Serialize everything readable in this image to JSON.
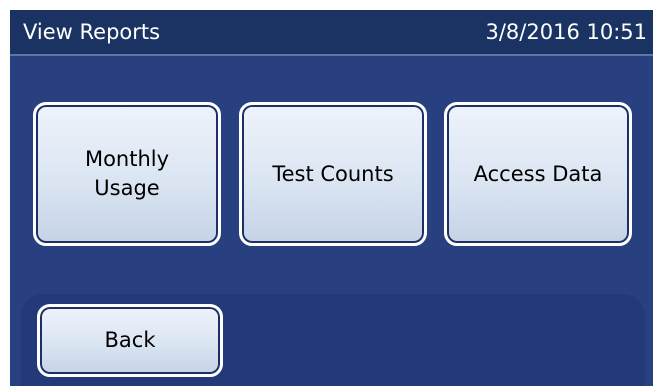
{
  "header": {
    "title": "View Reports",
    "datetime": "3/8/2016 10:51"
  },
  "buttons": {
    "monthly_usage_line1": "Monthly",
    "monthly_usage_line2": "Usage",
    "test_counts": "Test Counts",
    "access_data": "Access Data",
    "back": "Back"
  },
  "colors": {
    "header_background": "#1a3363",
    "screen_background": "#283f80",
    "footer_bar": "#23397a",
    "button_face": "#dbe5f2",
    "button_border": "#ffffff",
    "text_on_header": "#ffffff",
    "text_on_button": "#000000"
  }
}
